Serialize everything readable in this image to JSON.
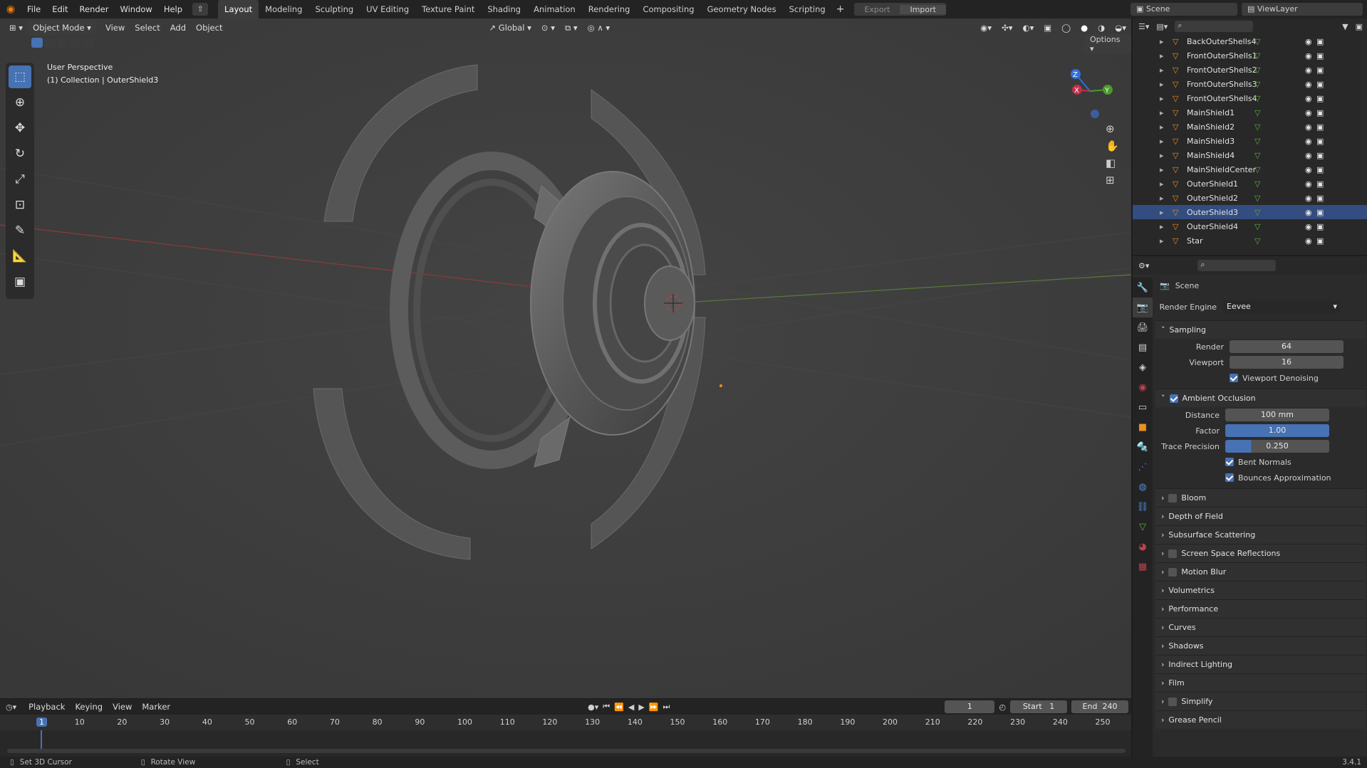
{
  "app": {
    "version": "3.4.1"
  },
  "menu": [
    "File",
    "Edit",
    "Render",
    "Window",
    "Help"
  ],
  "workspaces": [
    "Layout",
    "Modeling",
    "Sculpting",
    "UV Editing",
    "Texture Paint",
    "Shading",
    "Animation",
    "Rendering",
    "Compositing",
    "Geometry Nodes",
    "Scripting"
  ],
  "topbar": {
    "export_label": "Export",
    "import_label": "Import",
    "scene": "Scene",
    "view_layer": "ViewLayer"
  },
  "viewport": {
    "mode": "Object Mode",
    "menus": [
      "View",
      "Select",
      "Add",
      "Object"
    ],
    "transform": "Global",
    "options": "Options",
    "overlay_line1": "User Perspective",
    "overlay_line2": "(1) Collection | OuterShield3"
  },
  "gizmo": {
    "x": "X",
    "y": "Y",
    "z": "Z"
  },
  "outliner": {
    "items": [
      "BackOuterShells4",
      "FrontOuterShells1",
      "FrontOuterShells2",
      "FrontOuterShells3",
      "FrontOuterShells4",
      "MainShield1",
      "MainShield2",
      "MainShield3",
      "MainShield4",
      "MainShieldCenter",
      "OuterShield1",
      "OuterShield2",
      "OuterShield3",
      "OuterShield4",
      "Star"
    ],
    "selected": "OuterShield3"
  },
  "properties": {
    "title": "Scene",
    "render_engine_label": "Render Engine",
    "render_engine": "Eevee",
    "sampling": {
      "label": "Sampling",
      "render_label": "Render",
      "render": "64",
      "viewport_label": "Viewport",
      "viewport": "16",
      "denoise_label": "Viewport Denoising"
    },
    "ao": {
      "label": "Ambient Occlusion",
      "distance_label": "Distance",
      "distance": "100 mm",
      "factor_label": "Factor",
      "factor": "1.00",
      "trace_label": "Trace Precision",
      "trace": "0.250",
      "bent_label": "Bent Normals",
      "bounces_label": "Bounces Approximation"
    },
    "panels": [
      {
        "label": "Bloom",
        "check": true
      },
      {
        "label": "Depth of Field",
        "check": false
      },
      {
        "label": "Subsurface Scattering",
        "check": false
      },
      {
        "label": "Screen Space Reflections",
        "check": true
      },
      {
        "label": "Motion Blur",
        "check": true
      },
      {
        "label": "Volumetrics",
        "check": false
      },
      {
        "label": "Performance",
        "check": false
      },
      {
        "label": "Curves",
        "check": false
      },
      {
        "label": "Shadows",
        "check": false
      },
      {
        "label": "Indirect Lighting",
        "check": false
      },
      {
        "label": "Film",
        "check": false
      },
      {
        "label": "Simplify",
        "check": true
      },
      {
        "label": "Grease Pencil",
        "check": false
      }
    ]
  },
  "timeline": {
    "menus": [
      "Playback",
      "Keying",
      "View",
      "Marker"
    ],
    "current": "1",
    "start_label": "Start",
    "start": "1",
    "end_label": "End",
    "end": "240",
    "ticks": [
      "1",
      "10",
      "20",
      "30",
      "40",
      "50",
      "60",
      "70",
      "80",
      "90",
      "100",
      "110",
      "120",
      "130",
      "140",
      "150",
      "160",
      "170",
      "180",
      "190",
      "200",
      "210",
      "220",
      "230",
      "240",
      "250"
    ]
  },
  "status": {
    "left": "Set 3D Cursor",
    "mid": "Rotate View",
    "right": "Select"
  }
}
